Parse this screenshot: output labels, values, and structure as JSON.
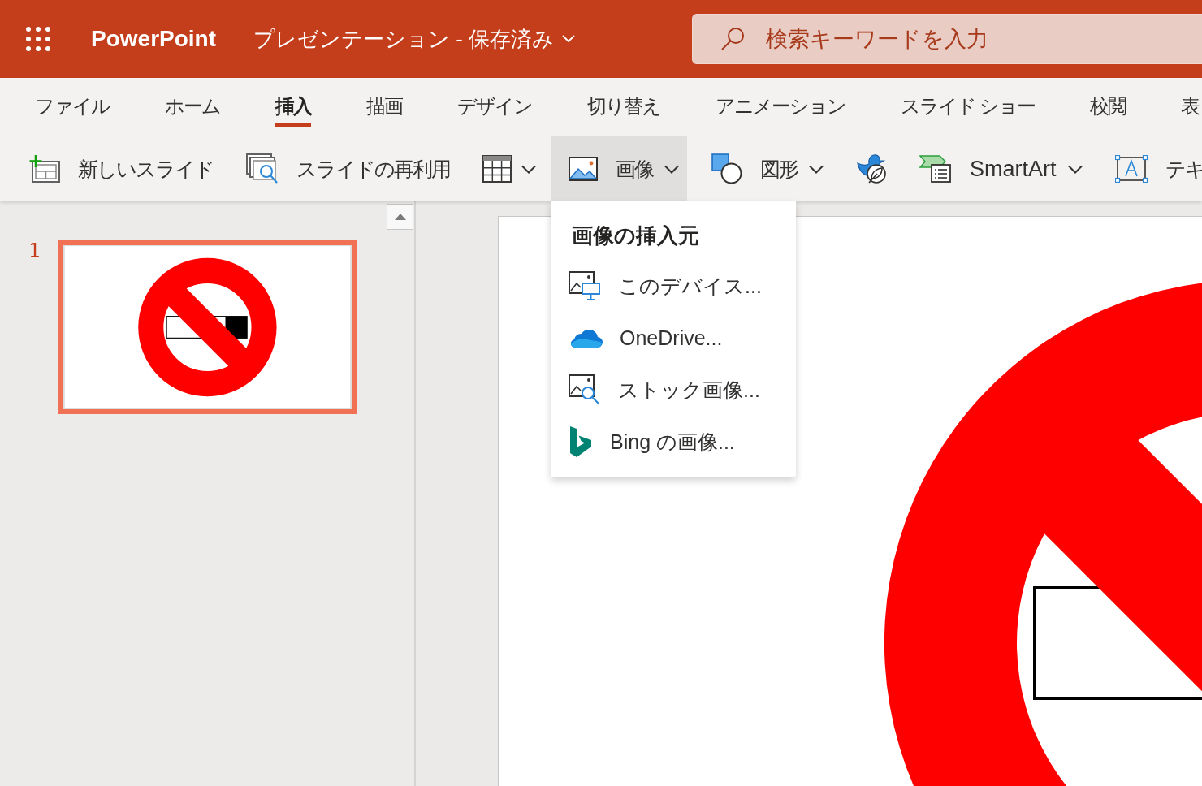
{
  "app_bar": {
    "app_name": "PowerPoint",
    "document_title": "プレゼンテーション - 保存済み",
    "search": {
      "placeholder": "検索キーワードを入力"
    }
  },
  "ribbon_tabs": [
    {
      "label": "ファイル",
      "selected": false
    },
    {
      "label": "ホーム",
      "selected": false
    },
    {
      "label": "挿入",
      "selected": true
    },
    {
      "label": "描画",
      "selected": false
    },
    {
      "label": "デザイン",
      "selected": false
    },
    {
      "label": "切り替え",
      "selected": false
    },
    {
      "label": "アニメーション",
      "selected": false
    },
    {
      "label": "スライド ショー",
      "selected": false
    },
    {
      "label": "校閲",
      "selected": false
    },
    {
      "label": "表",
      "selected": false
    }
  ],
  "toolbar": [
    {
      "kind": "button",
      "label": "新しいスライド"
    },
    {
      "kind": "button",
      "label": "スライドの再利用"
    },
    {
      "kind": "icon_menu",
      "expanded": false
    },
    {
      "kind": "menu",
      "label": "画像",
      "expanded": true
    },
    {
      "kind": "menu",
      "label": "図形",
      "expanded": false
    },
    {
      "kind": "icon"
    },
    {
      "kind": "menu",
      "label": "SmartArt",
      "expanded": false
    },
    {
      "kind": "button",
      "label": "テキ"
    }
  ],
  "picture_menu": {
    "title": "画像の挿入元",
    "items": [
      {
        "label": "このデバイス..."
      },
      {
        "label": "OneDrive..."
      },
      {
        "label": "ストック画像..."
      },
      {
        "label": "Bing の画像..."
      }
    ]
  },
  "slides": [
    {
      "number": "1",
      "selected": true
    }
  ]
}
